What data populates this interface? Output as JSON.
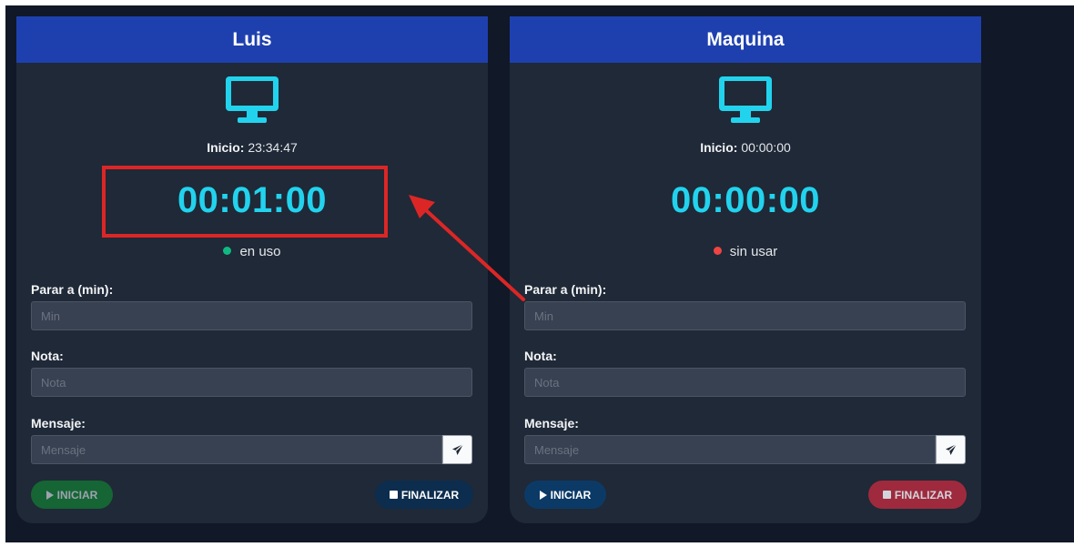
{
  "colors": {
    "page_bg": "#111827",
    "card_bg": "#1f2937",
    "header_bg": "#1e40af",
    "timer": "#22d3ee",
    "icon": "#22d3ee",
    "status_active": "#10b981",
    "status_idle": "#ef4444",
    "annotation": "#dc2626"
  },
  "cards": [
    {
      "title": "Luis",
      "icon": "desktop-monitor-icon",
      "inicio_label": "Inicio:",
      "inicio_value": "23:34:47",
      "timer": "00:01:00",
      "status": "en uso",
      "status_color": "#10b981",
      "stop_label": "Parar a (min):",
      "stop_placeholder": "Min",
      "note_label": "Nota:",
      "note_placeholder": "Nota",
      "message_label": "Mensaje:",
      "message_placeholder": "Mensaje",
      "send_icon": "paper-plane-icon",
      "iniciar_label": "INICIAR",
      "finalizar_label": "FINALIZAR",
      "iniciar_bg": "#166534",
      "iniciar_fg": "#9ca3af",
      "finalizar_bg": "#0c2d4e",
      "finalizar_fg": "#ffffff"
    },
    {
      "title": "Maquina",
      "icon": "desktop-monitor-icon",
      "inicio_label": "Inicio:",
      "inicio_value": "00:00:00",
      "timer": "00:00:00",
      "status": "sin usar",
      "status_color": "#ef4444",
      "stop_label": "Parar a (min):",
      "stop_placeholder": "Min",
      "note_label": "Nota:",
      "note_placeholder": "Nota",
      "message_label": "Mensaje:",
      "message_placeholder": "Mensaje",
      "send_icon": "paper-plane-icon",
      "iniciar_label": "INICIAR",
      "finalizar_label": "FINALIZAR",
      "iniciar_bg": "#0c3a66",
      "iniciar_fg": "#ffffff",
      "finalizar_bg": "#9f2a3d",
      "finalizar_fg": "#d1d5db"
    }
  ]
}
